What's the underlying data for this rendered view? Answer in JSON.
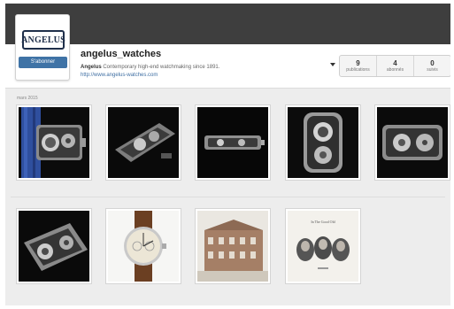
{
  "profile": {
    "logo_text": "ANGELUS",
    "follow_label": "S'abonner",
    "username": "angelus_watches",
    "bio_brand": "Angelus",
    "bio_text": " Contemporary high-end watchmaking since 1891.",
    "website": "http://www.angelus-watches.com"
  },
  "stats": [
    {
      "count": "9",
      "label": "publications"
    },
    {
      "count": "4",
      "label": "abonnés"
    },
    {
      "count": "0",
      "label": "suivis"
    }
  ],
  "feed": {
    "section_date": "mars 2015",
    "photo_text": "In The Good Old"
  },
  "colors": {
    "topbar": "#3e3e3e",
    "follow_button": "#3f73a6",
    "link": "#3f6fa3"
  }
}
